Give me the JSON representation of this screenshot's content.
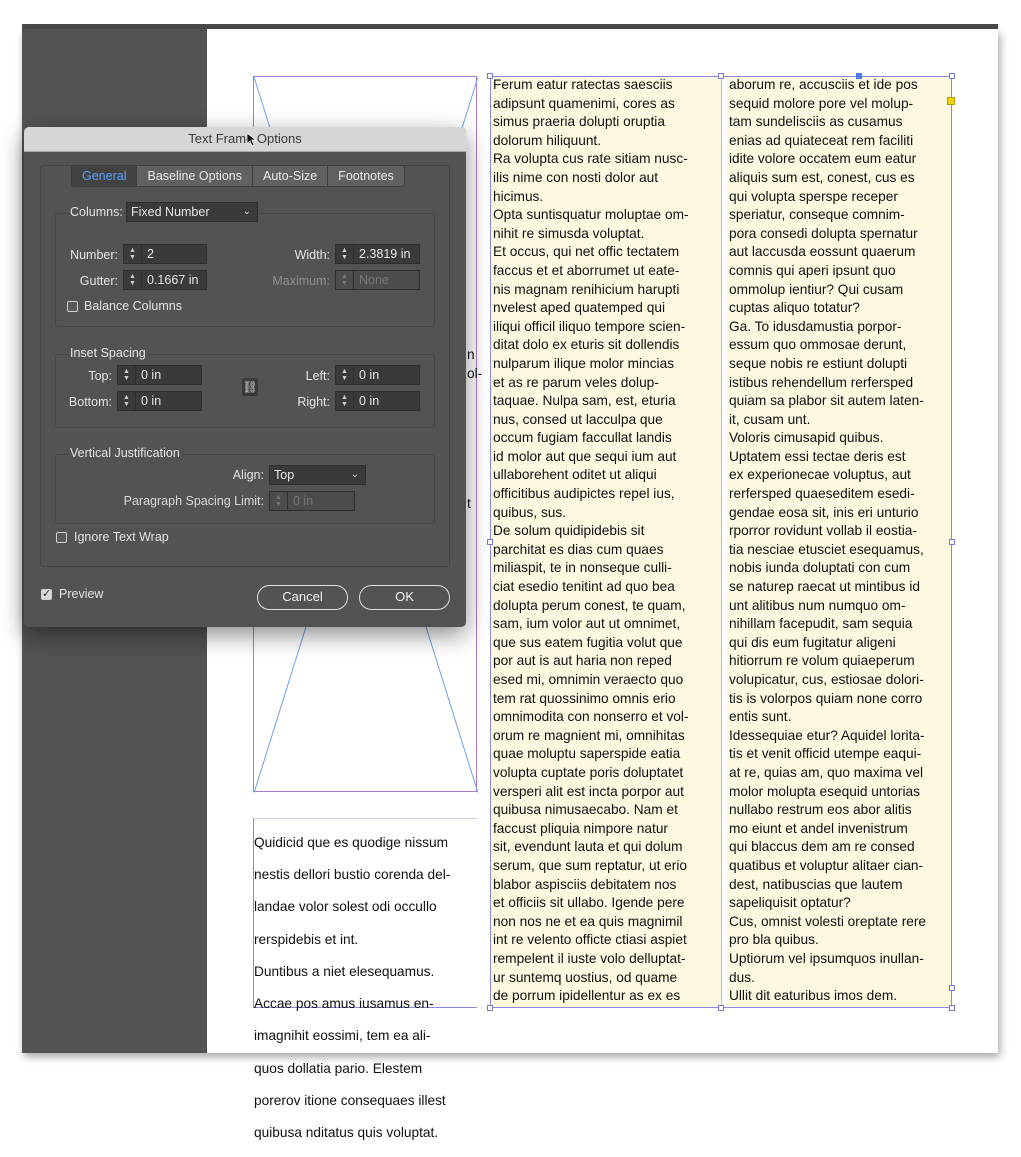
{
  "dialog": {
    "title": "Text Frame Options",
    "tabs": [
      "General",
      "Baseline Options",
      "Auto-Size",
      "Footnotes"
    ],
    "active_tab": "General",
    "columns": {
      "label": "Columns:",
      "type": "Fixed Number",
      "number_label": "Number:",
      "number": "2",
      "gutter_label": "Gutter:",
      "gutter": "0.1667 in",
      "width_label": "Width:",
      "width": "2.3819 in",
      "maximum_label": "Maximum:",
      "maximum": "None",
      "balance_label": "Balance Columns",
      "balance_checked": false
    },
    "inset": {
      "label": "Inset Spacing",
      "top_label": "Top:",
      "top": "0 in",
      "bottom_label": "Bottom:",
      "bottom": "0 in",
      "left_label": "Left:",
      "left": "0 in",
      "right_label": "Right:",
      "right": "0 in"
    },
    "vertical": {
      "label": "Vertical Justification",
      "align_label": "Align:",
      "align": "Top",
      "psl_label": "Paragraph Spacing Limit:",
      "psl": "0 in"
    },
    "ignore_wrap_label": "Ignore Text Wrap",
    "ignore_wrap_checked": false,
    "preview_label": "Preview",
    "preview_checked": true,
    "cancel_label": "Cancel",
    "ok_label": "OK"
  },
  "fragments": [
    "n",
    "ol-",
    "t"
  ],
  "lower_text": [
    "Quidicid que es quodige nissum",
    "nestis dellori bustio corenda del-",
    "landae volor solest odi occullo",
    "rerspidebis et int.",
    "Duntibus a niet elesequamus.",
    "Accae pos amus iusamus en-",
    "imagnihit eossimi, tem ea ali-",
    "quos dollatia pario. Elestem",
    "porerov itione consequaes illest",
    "quibusa nditatus quis voluptat."
  ],
  "column1_lines": [
    "Ferum eatur ratectas saesciis",
    "adipsunt quamenimi, cores as",
    "simus praeria dolupti oruptia",
    "dolorum hiliquunt.",
    "Ra volupta cus rate sitiam nusc-",
    "ilis nime con nosti dolor aut",
    "hicimus.",
    "Opta suntisquatur moluptae om-",
    "nihit re simusda voluptat.",
    "Et occus, qui net offic tectatem",
    "faccus et et aborrumet ut eate-",
    "nis magnam renihicium harupti",
    "nvelest aped quatemped qui",
    "iliqui officil iliquo tempore scien-",
    "ditat dolo ex eturis sit dollendis",
    "nulparum ilique molor mincias",
    "et as re parum veles dolup-",
    "taquae. Nulpa sam, est, eturia",
    "nus, consed ut lacculpa que",
    "occum fugiam faccullat landis",
    "id molor aut que sequi ium aut",
    "ullaborehent oditet ut aliqui",
    "officitibus audipictes repel ius,",
    "quibus, sus.",
    "De solum quidipidebis sit",
    "parchitat es dias cum quaes",
    "miliaspit, te in nonseque culli-",
    "ciat esedio tenitint ad quo bea",
    "dolupta perum conest, te quam,",
    "sam, ium volor aut ut omnimet,",
    "que sus eatem fugitia volut que",
    "por aut is aut haria non reped",
    "esed mi, omnimin veraecto quo",
    "tem rat quossinimo omnis erio",
    "omnimodita con nonserro et vol-",
    "orum re magnient mi, omnihitas",
    "quae moluptu saperspide eatia",
    "volupta cuptate poris doluptatet",
    "versperi alit est incta porpor aut",
    "quibusa nimusaecabo. Nam et",
    "faccust pliquia nimpore natur",
    "sit, evendunt lauta et qui dolum",
    "serum, que sum reptatur, ut erio",
    "blabor aspisciis debitatem nos",
    "et officiis sit ullabo. Igende pere",
    "non nos ne et ea quis magnimil",
    "int re velento officte ctiasi aspiet",
    "rempelent il iuste volo delluptat-",
    "ur suntemq uostius, od quame",
    "de porrum ipidellentur as ex es"
  ],
  "column2_lines": [
    "aborum re, accusciis et ide pos",
    "sequid molore pore vel molup-",
    "tam sundelisciis as cusamus",
    "enias ad quiateceat rem faciliti",
    "idite volore occatem eum eatur",
    "aliquis sum est, conest, cus es",
    "qui volupta sperspe receper",
    "speriatur, conseque comnim-",
    "pora consedi dolupta spernatur",
    "aut laccusda eossunt quaerum",
    "comnis qui aperi ipsunt quo",
    "ommolup ientiur? Qui cusam",
    "cuptas aliquo totatur?",
    "Ga. To idusdamustia porpor-",
    "essum quo ommosae derunt,",
    "seque nobis re estiunt dolupti",
    "istibus rehendellum rerfersped",
    "quiam sa plabor sit autem laten-",
    "it, cusam unt.",
    "Voloris cimusapid quibus.",
    "Uptatem essi tectae deris est",
    "ex experionecae voluptus, aut",
    "rerfersped quaeseditem esedi-",
    "gendae eosa sit, inis eri unturio",
    "rporror rovidunt vollab il eostia-",
    "tia nesciae etusciet esequamus,",
    "nobis iunda doluptati con cum",
    "se naturep raecat ut mintibus id",
    "unt alitibus num numquo om-",
    "nihillam facepudit, sam sequia",
    "qui dis eum fugitatur aligeni",
    "hitiorrum re volum quiaeperum",
    "volupicatur, cus, estiosae dolori-",
    "tis is volorpos quiam none corro",
    "entis sunt.",
    "Idessequiae etur? Aquidel lorita-",
    "tis et venit officid utempe eaqui-",
    "at re, quias am, quo maxima vel",
    "molor molupta esequid untorias",
    "nullabo restrum eos abor alitis",
    "mo eiunt et andel invenistrum",
    "qui blaccus dem am re consed",
    "quatibus et voluptur alitaer cian-",
    "dest, natibuscias que lautem",
    "sapeliquisit optatur?",
    "Cus, omnist volesti oreptate rere",
    "pro bla quibus.",
    "Uptiorum vel ipsumquos inullan-",
    "dus.",
    "Ullit dit eaturibus imos dem."
  ]
}
